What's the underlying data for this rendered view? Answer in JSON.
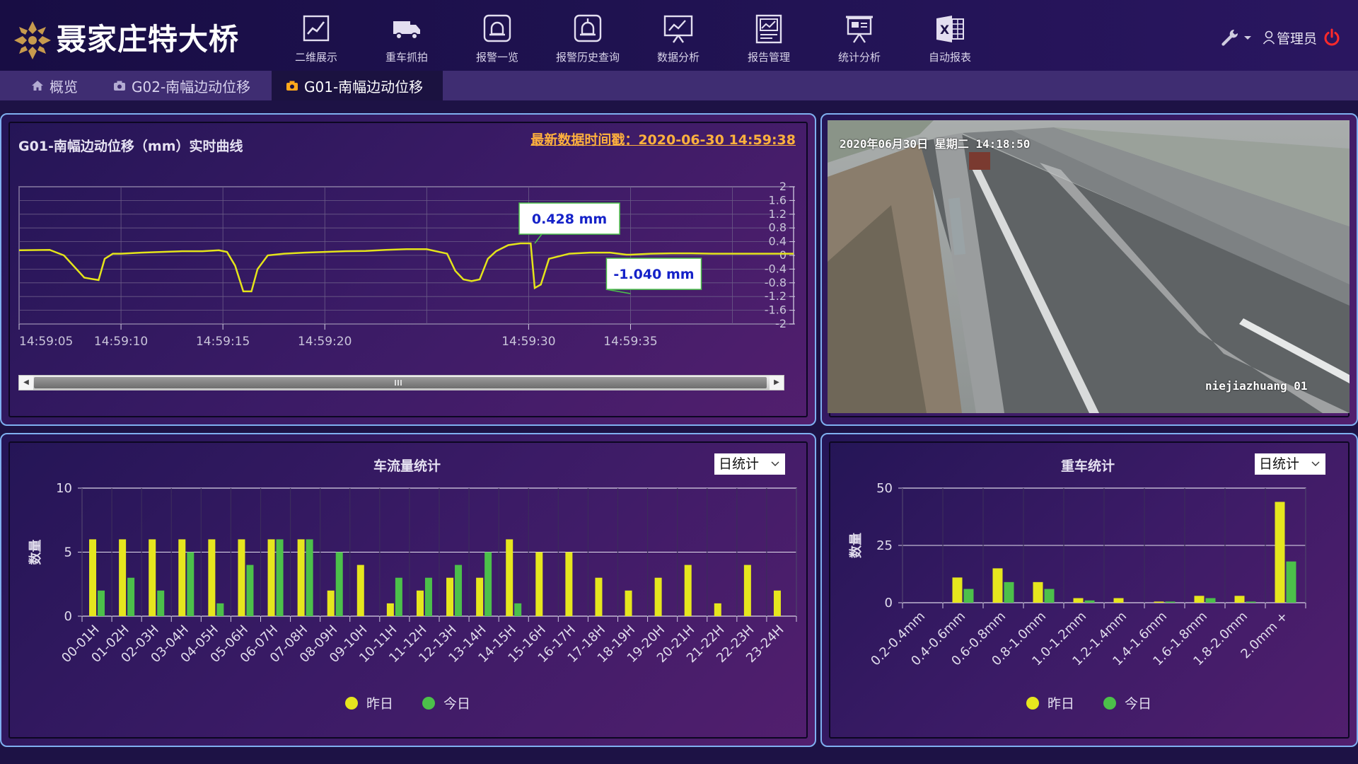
{
  "app": {
    "title": "聂家庄特大桥"
  },
  "nav": [
    {
      "label": "二维展示",
      "icon": "line-chart-icon"
    },
    {
      "label": "重车抓拍",
      "icon": "truck-icon"
    },
    {
      "label": "报警一览",
      "icon": "alarm-bell-icon"
    },
    {
      "label": "报警历史查询",
      "icon": "alarm-history-icon"
    },
    {
      "label": "数据分析",
      "icon": "analysis-board-icon"
    },
    {
      "label": "报告管理",
      "icon": "report-icon"
    },
    {
      "label": "统计分析",
      "icon": "presentation-icon"
    },
    {
      "label": "自动报表",
      "icon": "excel-icon"
    }
  ],
  "user": {
    "name": "管理员"
  },
  "tabs": [
    {
      "label": "概览",
      "icon": "home-icon",
      "active": false
    },
    {
      "label": "G02-南幅边动位移",
      "icon": "camera-icon",
      "active": false
    },
    {
      "label": "G01-南幅边动位移",
      "icon": "camera-icon",
      "active": true
    }
  ],
  "realtime": {
    "title": "G01-南幅边动位移（mm）实时曲线",
    "timestamp": "最新数据时间戳：2020-06-30 14:59:38",
    "max_label": "0.428 mm",
    "min_label": "-1.040 mm",
    "accent_color": "#ffb13d",
    "line_color": "#e4e41a"
  },
  "camera": {
    "datetime": "2020年06月30日  星期二  14:18:50",
    "name": "niejiazhuang 01"
  },
  "traffic": {
    "title": "车流量统计",
    "select": "日统计"
  },
  "heavy": {
    "title": "重车统计",
    "select": "日统计"
  },
  "legend": {
    "yesterday": "昨日",
    "today": "今日",
    "yesterday_color": "#e6e61e",
    "today_color": "#4cc04a"
  },
  "chart_data": [
    {
      "type": "line",
      "title": "G01-南幅边动位移（mm）实时曲线",
      "ylim": [
        -2,
        2
      ],
      "y_ticks": [
        "2",
        "1.6",
        "1.2",
        "0.8",
        "0.4",
        "0",
        "-0.4",
        "-0.8",
        "-1.2",
        "-1.6",
        "-2"
      ],
      "x_ticks": [
        "14:59:05",
        "14:59:10",
        "14:59:15",
        "14:59:20",
        "14:59:30",
        "14:59:35"
      ],
      "x_tick_values": [
        5,
        10,
        15,
        20,
        30,
        35
      ],
      "xlim": [
        5,
        43
      ],
      "grid": true,
      "annotations": [
        "0.428 mm",
        "-1.040 mm"
      ],
      "x": [
        5,
        6.5,
        7.2,
        8.2,
        8.9,
        9.2,
        9.6,
        10,
        11,
        12,
        13,
        14,
        14.8,
        15.2,
        15.6,
        16.0,
        16.4,
        16.7,
        17.2,
        18,
        19,
        20,
        21,
        22,
        23,
        24,
        25,
        26,
        26.4,
        26.8,
        27.2,
        27.6,
        28,
        28.4,
        29,
        29.6,
        30.1,
        30.3,
        30.6,
        31.0,
        32,
        33,
        34,
        34.8,
        35.0,
        36,
        37,
        38,
        39,
        40,
        41,
        42,
        43
      ],
      "y": [
        0.15,
        0.16,
        0.0,
        -0.65,
        -0.72,
        -0.1,
        0.05,
        0.05,
        0.08,
        0.1,
        0.12,
        0.12,
        0.15,
        0.1,
        -0.3,
        -1.05,
        -1.05,
        -0.4,
        0.0,
        0.05,
        0.08,
        0.1,
        0.12,
        0.13,
        0.16,
        0.18,
        0.18,
        0.05,
        -0.45,
        -0.7,
        -0.75,
        -0.7,
        -0.1,
        0.12,
        0.3,
        0.35,
        0.35,
        -0.95,
        -0.85,
        -0.1,
        0.05,
        0.08,
        0.08,
        0.02,
        0.02,
        0.05,
        0.06,
        0.06,
        0.05,
        0.05,
        0.05,
        0.05,
        0.05
      ]
    },
    {
      "type": "bar",
      "title": "车流量统计",
      "ylabel": "数量",
      "ylim": [
        0,
        10
      ],
      "y_ticks": [
        0,
        5,
        10
      ],
      "categories": [
        "00-01H",
        "01-02H",
        "02-03H",
        "03-04H",
        "04-05H",
        "05-06H",
        "06-07H",
        "07-08H",
        "08-09H",
        "09-10H",
        "10-11H",
        "11-12H",
        "12-13H",
        "13-14H",
        "14-15H",
        "15-16H",
        "16-17H",
        "17-18H",
        "18-19H",
        "19-20H",
        "20-21H",
        "21-22H",
        "22-23H",
        "23-24H"
      ],
      "series": [
        {
          "name": "昨日",
          "values": [
            6,
            6,
            6,
            6,
            6,
            6,
            6,
            6,
            2,
            4,
            1,
            2,
            3,
            3,
            6,
            5,
            5,
            3,
            2,
            3,
            4,
            1,
            4,
            2
          ]
        },
        {
          "name": "今日",
          "values": [
            2,
            3,
            2,
            5,
            1,
            4,
            6,
            6,
            5,
            0,
            3,
            3,
            4,
            5,
            1,
            0,
            0,
            0,
            0,
            0,
            0,
            0,
            0,
            0
          ]
        }
      ],
      "legend": "bottom",
      "grid": true
    },
    {
      "type": "bar",
      "title": "重车统计",
      "ylabel": "数量",
      "ylim": [
        0,
        50
      ],
      "y_ticks": [
        0,
        25,
        50
      ],
      "categories": [
        "0.2-0.4mm",
        "0.4-0.6mm",
        "0.6-0.8mm",
        "0.8-1.0mm",
        "1.0-1.2mm",
        "1.2-1.4mm",
        "1.4-1.6mm",
        "1.6-1.8mm",
        "1.8-2.0mm",
        "2.0mm +"
      ],
      "series": [
        {
          "name": "昨日",
          "values": [
            0,
            11,
            15,
            9,
            2,
            2,
            0.5,
            3,
            3,
            44
          ]
        },
        {
          "name": "今日",
          "values": [
            0,
            6,
            9,
            6,
            1,
            0,
            0.5,
            2,
            0.5,
            18
          ]
        }
      ],
      "legend": "bottom",
      "grid": true
    }
  ]
}
